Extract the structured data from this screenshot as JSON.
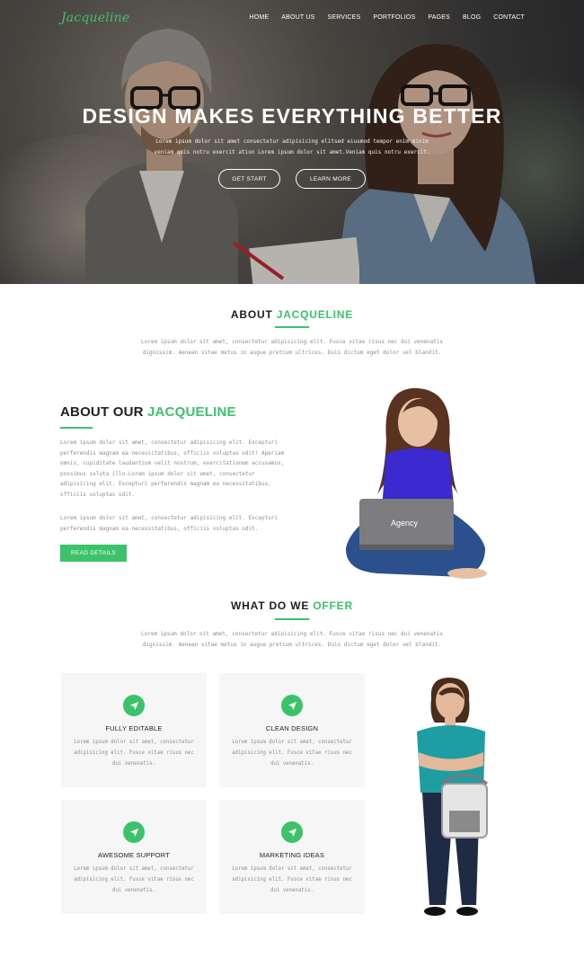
{
  "brand": {
    "logo": "Jacqueline",
    "accent_color": "#3cc26b"
  },
  "nav": {
    "items": [
      "HOME",
      "ABOUT US",
      "SERVICES",
      "PORTFOLIOS",
      "PAGES",
      "BLOG",
      "CONTACT"
    ]
  },
  "hero": {
    "title": "DESIGN MAKES EVERYTHING BETTER",
    "subtitle": "Lorem ipsum dolor sit amet consectetur adipisicing elitsed eiusmod tempor enim minim veniam quis notru exercit ation Lorem ipsum dolor sit amet.Veniam quis notru exercit.",
    "buttons": {
      "get_start": "GET START",
      "learn_more": "LEARN MORE"
    }
  },
  "about_section": {
    "title_main": "ABOUT",
    "title_accent": "JACQUELINE",
    "text": "Lorem ipsum dolor sit amet, consectetur adipisicing elit. Fusce vitae risus nec dui venenatis dignissim. Aenean vitae metus in augue pretium ultrices. Duis dictum eget dolor vel blandit."
  },
  "about_our": {
    "heading_main": "ABOUT OUR",
    "heading_accent": "JACQUELINE",
    "paragraph1": "Lorem ipsum dolor sit amet, consectetur adipisicing elit. Excepturi perferendis magnam ea necessitatibus, officiis voluptas odit! Aperiam omnis, cupiditate laudantium velit nostrum, exercitationem accusamus, possimus soluta illo.Lorem ipsum dolor sit amet, consectetur adipisicing elit. Excepturi perferendis magnam ea necessitatibus, officiis voluptas odit.",
    "paragraph2": "Lorem ipsum dolor sit amet, consectetur adipisicing elit. Excepturi perferendis magnam ea necessitatibus, officiis voluptas odit.",
    "button": "READ DETAILS",
    "laptop_label": "Agency"
  },
  "offer_section": {
    "title_main": "WHAT DO WE",
    "title_accent": "OFFER",
    "text": "Lorem ipsum dolor sit amet, consectetur adipisicing elit. Fusce vitae risus nec dui venenatis dignissim. Aenean vitae metus in augue pretium ultrices. Duis dictum eget dolor vel blandit.",
    "cards": [
      {
        "title": "FULLY EDITABLE",
        "icon": "location-arrow-icon",
        "text": "Lorem ipsum dolor sit amet, consectetur adipisicing elit. Fusce vitae risus nec dui venenatis."
      },
      {
        "title": "CLEAN DESIGN",
        "icon": "location-arrow-icon",
        "text": "Lorem ipsum dolor sit amet, consectetur adipisicing elit. Fusce vitae risus nec dui venenatis."
      },
      {
        "title": "AWESOME SUPPORT",
        "icon": "location-arrow-icon",
        "text": "Lorem ipsum dolor sit amet, consectetur adipisicing elit. Fusce vitae risus nec dui venenatis."
      },
      {
        "title": "MARKETING IDEAS",
        "icon": "location-arrow-icon",
        "text": "Lorem ipsum dolor sit amet, consectetur adipisicing elit. Fusce vitae risus nec dui venenatis."
      }
    ]
  }
}
